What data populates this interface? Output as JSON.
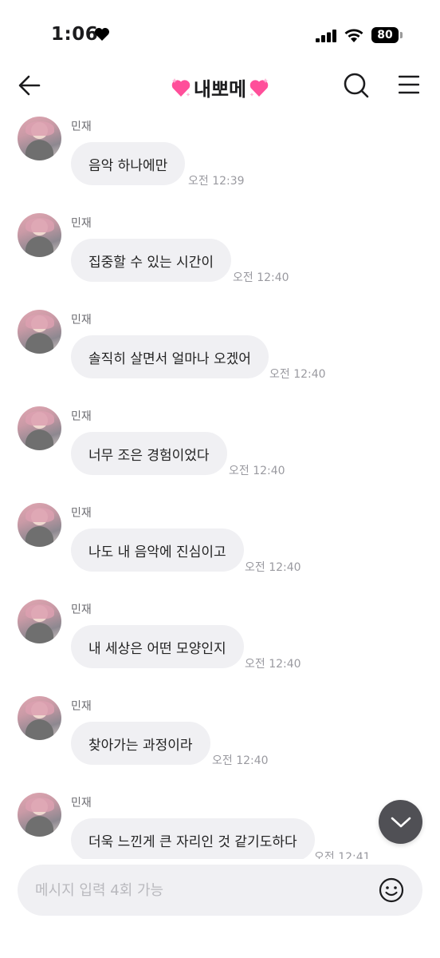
{
  "status_bar": {
    "time": "1:06",
    "battery": "80"
  },
  "header": {
    "title": "내뽀메"
  },
  "messages": [
    {
      "sender": "민재",
      "text": "음악 하나에만",
      "time": "오전 12:39"
    },
    {
      "sender": "민재",
      "text": "집중할 수 있는 시간이",
      "time": "오전 12:40"
    },
    {
      "sender": "민재",
      "text": "솔직히 살면서 얼마나 오겠어",
      "time": "오전 12:40"
    },
    {
      "sender": "민재",
      "text": "너무 조은 경험이었다",
      "time": "오전 12:40"
    },
    {
      "sender": "민재",
      "text": "나도 내 음악에 진심이고",
      "time": "오전 12:40"
    },
    {
      "sender": "민재",
      "text": "내 세상은 어떤 모양인지",
      "time": "오전 12:40"
    },
    {
      "sender": "민재",
      "text": "찾아가는 과정이라",
      "time": "오전 12:40"
    },
    {
      "sender": "민재",
      "text": "더욱 느낀게 큰 자리인 것 같기도하다",
      "time": "오전 12:41"
    }
  ],
  "input": {
    "placeholder": "메시지 입력 4회 가능",
    "value": ""
  },
  "icons": {
    "back": "back-arrow-icon",
    "search": "search-icon",
    "menu": "menu-icon",
    "emoji": "emoji-icon",
    "scroll": "chevron-down-icon",
    "title_heart": "pink-heart-icon"
  },
  "colors": {
    "bubble": "#f0f0f3",
    "heart": "#ff4f9a",
    "fab": "#505055"
  }
}
